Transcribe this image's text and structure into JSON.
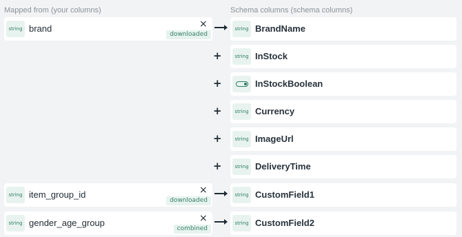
{
  "headers": {
    "left": "Mapped from (your columns)",
    "right": "Schema columns (schema columns)"
  },
  "icons": {
    "remove": "×",
    "add": "+"
  },
  "rows": [
    {
      "source": {
        "type": "string",
        "name": "brand",
        "tag": "downloaded"
      },
      "target": {
        "type": "string",
        "name": "BrandName"
      }
    },
    {
      "target": {
        "type": "string",
        "name": "InStock"
      }
    },
    {
      "target": {
        "type": "toggle-icon",
        "name": "InStockBoolean"
      }
    },
    {
      "target": {
        "type": "string",
        "name": "Currency"
      }
    },
    {
      "target": {
        "type": "string",
        "name": "ImageUrl"
      }
    },
    {
      "target": {
        "type": "string",
        "name": "DeliveryTime"
      }
    },
    {
      "source": {
        "type": "string",
        "name": "item_group_id",
        "tag": "downloaded"
      },
      "target": {
        "type": "string",
        "name": "CustomField1"
      }
    },
    {
      "source": {
        "type": "string",
        "name": "gender_age_group",
        "tag": "combined"
      },
      "target": {
        "type": "string",
        "name": "CustomField2"
      }
    }
  ],
  "colors": {
    "background": "#f2f3f4",
    "chip_bg": "#e8f3ef",
    "chip_text": "#2f7c63"
  }
}
